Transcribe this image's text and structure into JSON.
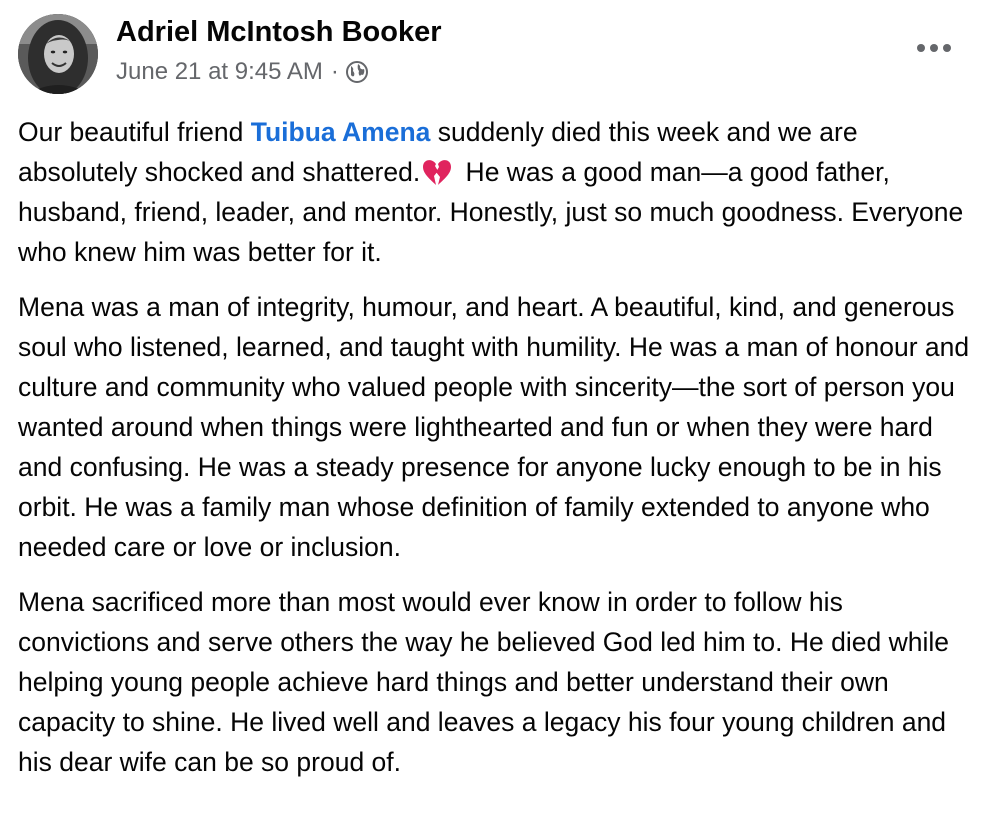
{
  "post": {
    "author": "Adriel McIntosh Booker",
    "timestamp": "June 21 at 9:45 AM",
    "separator": "·",
    "privacy_icon": "globe-icon",
    "more_icon": "more-options-icon",
    "avatar_icon": "profile-photo",
    "paragraph_1": {
      "before_mention": "Our beautiful friend ",
      "mention": "Tuibua Amena",
      "after_mention": "  suddenly died this week and we are absolutely shocked and shattered.",
      "emoji": "broken-heart-icon",
      "after_emoji": " He was a good man—a good father, husband, friend, leader, and mentor. Honestly, just so much goodness. Everyone who knew him was better for it."
    },
    "paragraph_2": "Mena was a man of integrity, humour, and heart. A beautiful, kind, and generous soul who listened, learned, and taught with humility. He was a man of honour and culture and community who valued people with sincerity—the sort of person you wanted around when things were lighthearted and fun or when they were hard and confusing. He was a steady presence for anyone lucky enough to be in his orbit. He was a family man whose definition of family extended to anyone who needed care or love or inclusion.",
    "paragraph_3": "Mena sacrificed more than most would ever know in order to follow his convictions and serve others the way he believed God led him to. He died while helping young people achieve hard things  and better understand their own capacity to shine. He lived well and leaves a legacy his four young children and his dear wife can be so proud of."
  },
  "colors": {
    "text": "#050505",
    "secondary_text": "#65676b",
    "link": "#1a6ed8",
    "emoji_red": "#e0245e"
  }
}
